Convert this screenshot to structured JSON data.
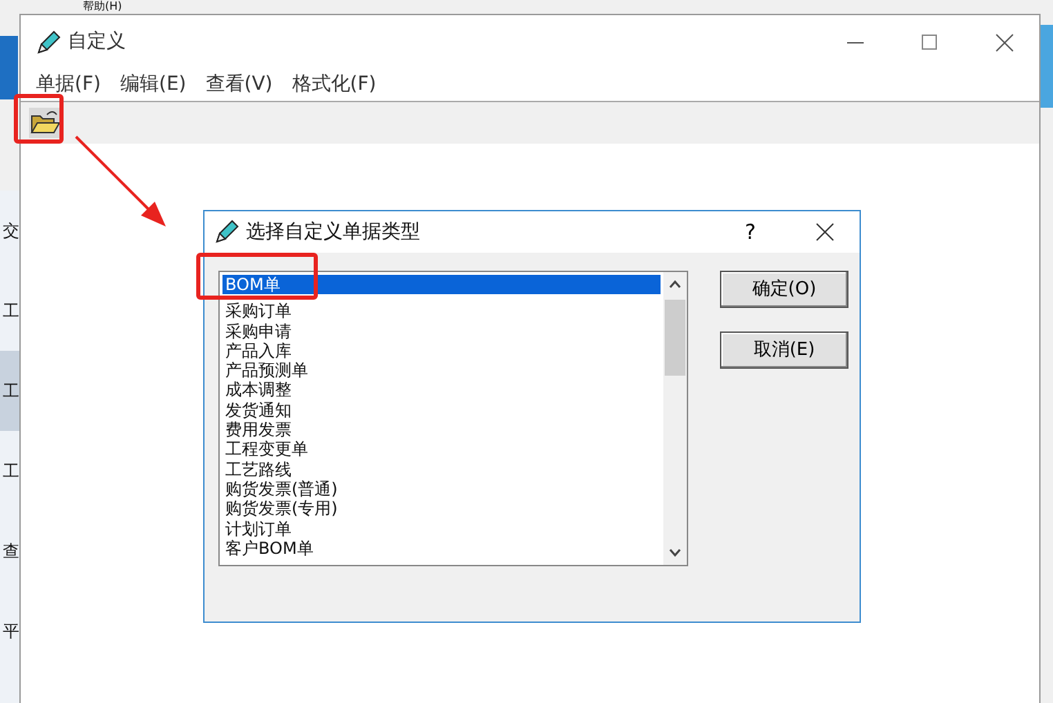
{
  "background_app": {
    "menu_item": "帮助(H)",
    "side_items": [
      {
        "label": "交",
        "selected": false
      },
      {
        "label": "工",
        "selected": false
      },
      {
        "label": "工",
        "selected": true
      },
      {
        "label": "工",
        "selected": false
      },
      {
        "label": "查",
        "selected": false
      },
      {
        "label": "平",
        "selected": false
      }
    ]
  },
  "window": {
    "title": "自定义",
    "menu": [
      "单据(F)",
      "编辑(E)",
      "查看(V)",
      "格式化(F)"
    ]
  },
  "dialog": {
    "title": "选择自定义单据类型",
    "help": "?",
    "items": [
      {
        "label": "BOM单",
        "selected": true
      },
      {
        "label": "采购订单",
        "selected": false
      },
      {
        "label": "采购申请",
        "selected": false
      },
      {
        "label": "产品入库",
        "selected": false
      },
      {
        "label": "产品预测单",
        "selected": false
      },
      {
        "label": "成本调整",
        "selected": false
      },
      {
        "label": "发货通知",
        "selected": false
      },
      {
        "label": "费用发票",
        "selected": false
      },
      {
        "label": "工程变更单",
        "selected": false
      },
      {
        "label": "工艺路线",
        "selected": false
      },
      {
        "label": "购货发票(普通)",
        "selected": false
      },
      {
        "label": "购货发票(专用)",
        "selected": false
      },
      {
        "label": "计划订单",
        "selected": false
      },
      {
        "label": "客户BOM单",
        "selected": false
      }
    ],
    "buttons": [
      "确定(O)",
      "取消(E)"
    ]
  }
}
